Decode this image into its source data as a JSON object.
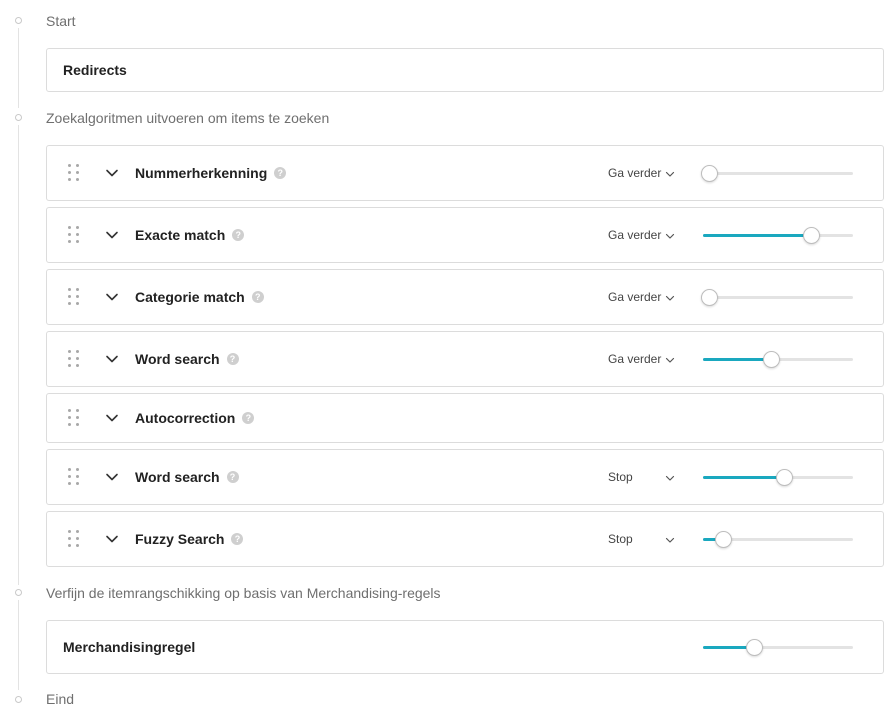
{
  "steps": {
    "start": "Start",
    "search": "Zoekalgoritmen uitvoeren om items te zoeken",
    "refine": "Verfijn de itemrangschikking op basis van Merchandising-regels",
    "end": "Eind"
  },
  "redirects": {
    "title": "Redirects"
  },
  "algorithms": [
    {
      "title": "Nummerherkenning",
      "action": "Ga verder",
      "level": 0.0
    },
    {
      "title": "Exacte match",
      "action": "Ga verder",
      "level": 0.72
    },
    {
      "title": "Categorie match",
      "action": "Ga verder",
      "level": 0.0
    },
    {
      "title": "Word search",
      "action": "Ga verder",
      "level": 0.45
    },
    {
      "title": "Autocorrection",
      "action": "",
      "level": null
    },
    {
      "title": "Word search",
      "action": "Stop",
      "level": 0.54
    },
    {
      "title": "Fuzzy Search",
      "action": "Stop",
      "level": 0.13
    }
  ],
  "merchandising": {
    "title": "Merchandisingregel",
    "level": 0.34
  },
  "help_glyph": "?",
  "colors": {
    "accent": "#1aa8bf",
    "border": "#dcdcdc",
    "muted_text": "#6f6f6f"
  }
}
